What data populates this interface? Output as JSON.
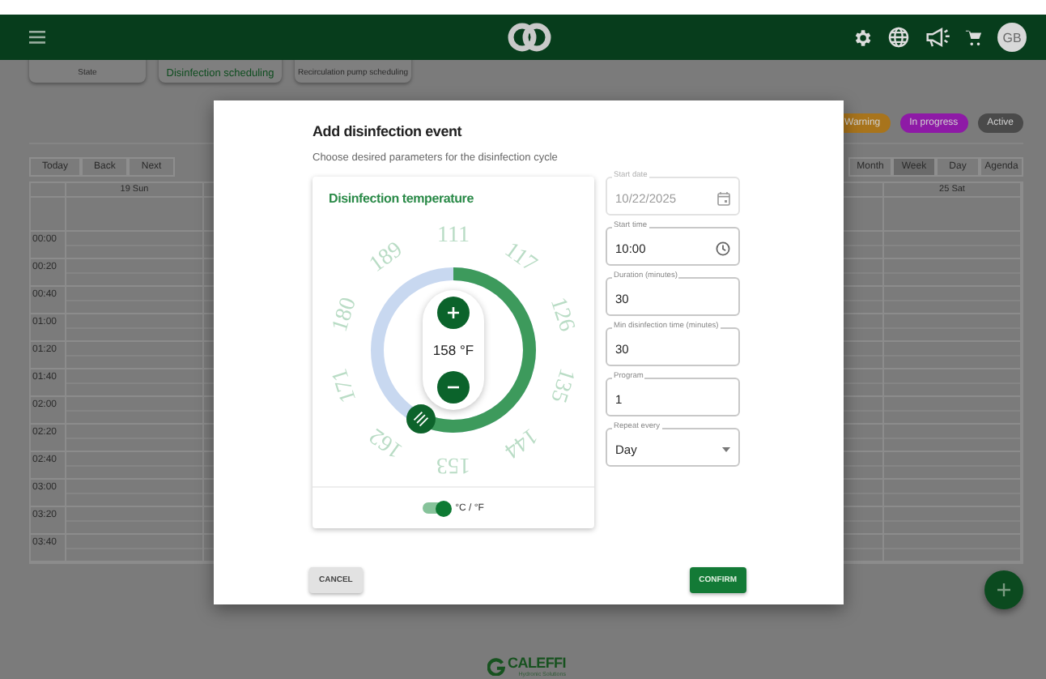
{
  "header": {
    "avatar": "GB"
  },
  "tabs": [
    {
      "label": "State",
      "selected": false
    },
    {
      "label": "Disinfection scheduling",
      "selected": true
    },
    {
      "label": "Recirculation pump scheduling",
      "selected": false
    }
  ],
  "status_legend": [
    {
      "label": "Warning",
      "color": "#a8741c"
    },
    {
      "label": "In progress",
      "color": "#8e1aa6"
    },
    {
      "label": "Active",
      "color": "#4a4a4a"
    }
  ],
  "calendar": {
    "nav_buttons": [
      "Today",
      "Back",
      "Next"
    ],
    "views": [
      {
        "label": "Month",
        "selected": false
      },
      {
        "label": "Week",
        "selected": true
      },
      {
        "label": "Day",
        "selected": false
      },
      {
        "label": "Agenda",
        "selected": false
      }
    ],
    "day_headers": [
      "19 Sun",
      "25 Sat"
    ],
    "times": [
      "00:00",
      "00:20",
      "00:40",
      "01:00",
      "01:20",
      "01:40",
      "02:00",
      "02:20",
      "02:40",
      "03:00",
      "03:20",
      "03:40"
    ]
  },
  "dialog": {
    "title": "Add disinfection event",
    "subtitle": "Choose desired parameters for the disinfection cycle",
    "temperature": {
      "title": "Disinfection temperature",
      "reading": "158 °F",
      "scale": [
        "111",
        "117",
        "126",
        "135",
        "144",
        "153",
        "162",
        "171",
        "180",
        "189"
      ],
      "unit_toggle": {
        "label": "°C / °F",
        "on": true
      }
    },
    "fields": [
      {
        "label": "Start date",
        "value": "10/22/2025",
        "kind": "date",
        "disabled": true
      },
      {
        "label": "Start time",
        "value": "10:00",
        "kind": "time",
        "disabled": false
      },
      {
        "label": "Duration (minutes)",
        "value": "30",
        "kind": "text",
        "disabled": false
      },
      {
        "label": "Min disinfection time (minutes)",
        "value": "30",
        "kind": "text",
        "disabled": false
      },
      {
        "label": "Program",
        "value": "1",
        "kind": "text",
        "disabled": false
      },
      {
        "label": "Repeat every",
        "value": "Day",
        "kind": "select",
        "disabled": false
      }
    ],
    "buttons": [
      {
        "label": "CANCEL",
        "kind": "secondary"
      },
      {
        "label": "CONFIRM",
        "kind": "primary"
      }
    ]
  },
  "footer": {
    "brand": "CALEFFI",
    "tagline": "Hydronic Solutions"
  }
}
